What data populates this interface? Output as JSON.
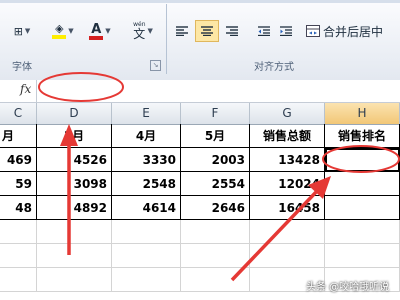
{
  "ribbon": {
    "groups": {
      "font_label": "字体",
      "align_label": "对齐方式"
    },
    "tools": {
      "border_icon": "⊞",
      "fill_icon": "◈",
      "font_color_letter": "A",
      "wen_sup": "wén",
      "wen_char": "文",
      "merge_label": "合并后居中"
    },
    "colors": {
      "fill": "#ffee00",
      "font": "#d42020"
    }
  },
  "formula_bar": {
    "fx_label": "fx",
    "value": ""
  },
  "columns": [
    "C",
    "D",
    "E",
    "F",
    "G",
    "H"
  ],
  "selected_column": "H",
  "sheet": {
    "header": [
      "月",
      "3月",
      "4月",
      "5月",
      "销售总额",
      "销售排名"
    ],
    "rows": [
      [
        "469",
        "4526",
        "3330",
        "2003",
        "13428",
        ""
      ],
      [
        "59",
        "3098",
        "2548",
        "2554",
        "12024",
        ""
      ],
      [
        "48",
        "4892",
        "4614",
        "2646",
        "16458",
        ""
      ]
    ]
  },
  "watermark": "头条 @咬哈哦听说"
}
